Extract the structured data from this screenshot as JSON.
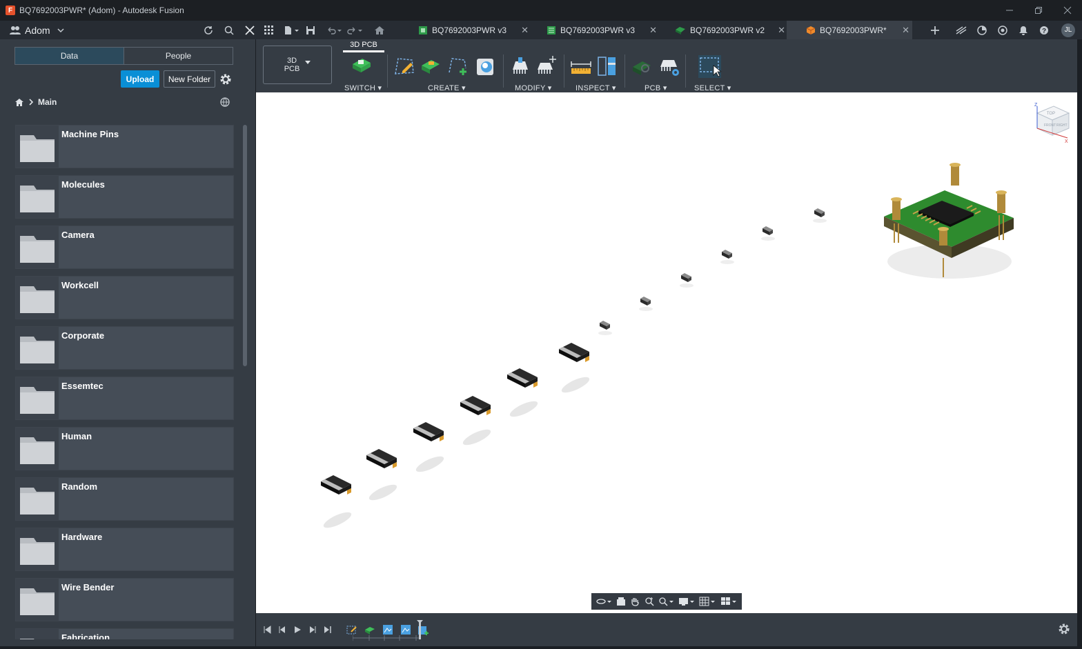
{
  "window": {
    "title": "BQ7692003PWR* (Adom) - Autodesk Fusion"
  },
  "team": {
    "name": "Adom"
  },
  "tabs": [
    {
      "label": "BQ7692003PWR v3",
      "icon": "schematic-icon"
    },
    {
      "label": "BQ7692003PWR v3",
      "icon": "pcb-icon"
    },
    {
      "label": "BQ7692003PWR v2",
      "icon": "board-icon"
    },
    {
      "label": "BQ7692003PWR*",
      "icon": "3d-box-icon"
    }
  ],
  "user": {
    "initials": "JL"
  },
  "panel": {
    "seg_data": "Data",
    "seg_people": "People",
    "upload": "Upload",
    "new_folder": "New Folder",
    "breadcrumb": "Main",
    "folders": [
      "Machine Pins",
      "Molecules",
      "Camera",
      "Workcell",
      "Corporate",
      "Essemtec",
      "Human",
      "Random",
      "Hardware",
      "Wire Bender",
      "Fabrication"
    ]
  },
  "toolbar": {
    "workspace": "3D\nPCB",
    "workspace_tab": "3D PCB",
    "groups": {
      "switch": "SWITCH",
      "create": "CREATE",
      "modify": "MODIFY",
      "inspect": "INSPECT",
      "pcb": "PCB",
      "select": "SELECT"
    }
  },
  "viewcube": {
    "top": "TOP",
    "front": "FRONT",
    "right": "RIGHT",
    "axis_x": "X",
    "axis_z": "Z"
  },
  "colors": {
    "accent": "#0a8fd6",
    "board_green": "#2e8b2e",
    "gold": "#c9a24a",
    "chip": "#1a1a1a"
  }
}
